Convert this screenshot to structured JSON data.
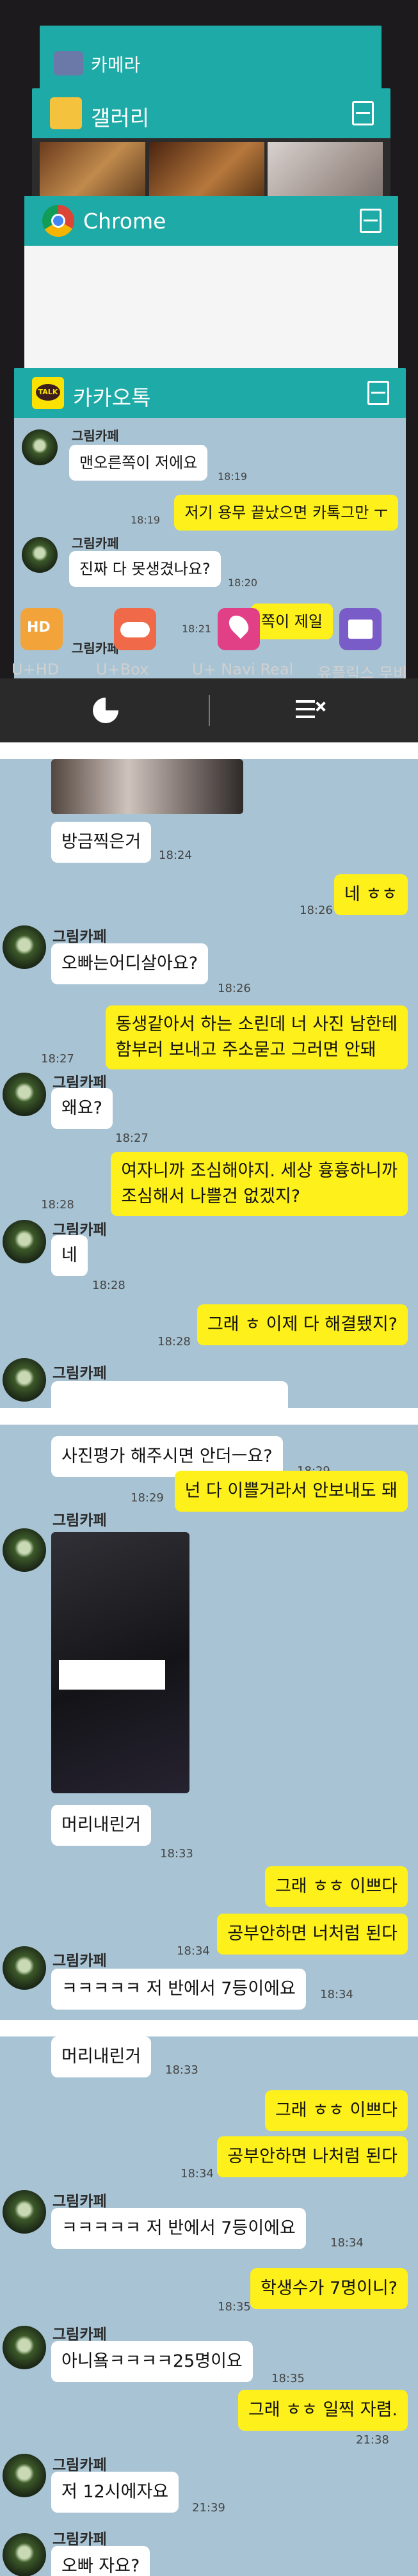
{
  "recents": {
    "camera_title": "카메라",
    "gallery_title": "갤러리",
    "chrome_title": "Chrome",
    "kakao_title": "카카오톡",
    "preview_messages": [
      {
        "kind": "in",
        "sender": "그림카페",
        "text": "맨오른쪽이 저에요",
        "time": "18:19"
      },
      {
        "kind": "out",
        "text": "저기 용무 끝났으면 카톡그만 ㅜ",
        "time": "18:19"
      },
      {
        "kind": "in",
        "sender": "그림카페",
        "text": "진짜 다 못생겼나요?",
        "time": "18:20"
      },
      {
        "kind": "in",
        "sender": "그림카페",
        "text": "",
        "time": "18:21"
      },
      {
        "kind": "out",
        "text": "쪽이 제일",
        "time": ""
      }
    ],
    "dock": [
      {
        "name": "U+HD",
        "label": "U+HD",
        "color": "#f2a43a"
      },
      {
        "name": "U+Box",
        "label": "U+Box",
        "color": "#f06a4a"
      },
      {
        "name": "U+ Navi Real",
        "label": "U+ Navi Real",
        "color": "#e13f86"
      },
      {
        "name": "U+movie",
        "label": "유플릭스 무비",
        "color": "#7a5cc8"
      }
    ],
    "nav": {
      "recent_icon": "pie-icon",
      "close_all_icon": "clear-all-icon"
    }
  },
  "chat1": {
    "messages": [
      {
        "kind": "in",
        "text": "방금찍은거",
        "time": "18:24"
      },
      {
        "kind": "out",
        "text": "네 ㅎㅎ",
        "time": "18:26"
      },
      {
        "kind": "in",
        "sender": "그림카페",
        "text": "오빠는어디살아요?",
        "time": "18:26"
      },
      {
        "kind": "out",
        "text": "동생같아서 하는 소린데 너 사진 남한테\n함부러 보내고 주소묻고 그러면 안돼",
        "time": "18:27"
      },
      {
        "kind": "in",
        "sender": "그림카페",
        "text": "왜요?",
        "time": "18:27"
      },
      {
        "kind": "out",
        "text": "여자니까 조심해야지. 세상 흉흉하니까\n조심해서 나쁠건 없겠지?",
        "time": "18:28"
      },
      {
        "kind": "in",
        "sender": "그림카페",
        "text": "네",
        "time": "18:28"
      },
      {
        "kind": "out",
        "text": "그래 ㅎ 이제 다 해결됐지?",
        "time": "18:28"
      },
      {
        "kind": "in",
        "sender": "그림카페",
        "text": "",
        "time": ""
      }
    ]
  },
  "chat2": {
    "messages": [
      {
        "kind": "in",
        "text": "사진평가 해주시면 안더ㅡ요?",
        "time": "18:29"
      },
      {
        "kind": "out",
        "text": "넌 다 이쁠거라서 안보내도 돼",
        "time": "18:29"
      },
      {
        "kind": "in",
        "sender": "그림카페",
        "text": "머리내린거",
        "time": "18:33"
      },
      {
        "kind": "out",
        "text": "그래 ㅎㅎ 이쁘다",
        "time": ""
      },
      {
        "kind": "out",
        "text": "공부안하면 너처럼 된다",
        "time": "18:34"
      },
      {
        "kind": "in",
        "sender": "그림카페",
        "text": "ㅋㅋㅋㅋㅋ 저 반에서 7등이에요",
        "time": "18:34"
      }
    ]
  },
  "chat3": {
    "messages": [
      {
        "kind": "in",
        "text": "머리내린거",
        "time": "18:33"
      },
      {
        "kind": "out",
        "text": "그래 ㅎㅎ 이쁘다",
        "time": ""
      },
      {
        "kind": "out",
        "text": "공부안하면 나처럼 된다",
        "time": "18:34"
      },
      {
        "kind": "in",
        "sender": "그림카페",
        "text": "ㅋㅋㅋㅋㅋ 저 반에서 7등이에요",
        "time": "18:34"
      },
      {
        "kind": "out",
        "text": "학생수가 7명이니?",
        "time": "18:35"
      },
      {
        "kind": "in",
        "sender": "그림카페",
        "text": "아니욬ㅋㅋㅋㅋ25명이요",
        "time": "18:35"
      },
      {
        "kind": "out",
        "text": "그래 ㅎㅎ 일찍 자렴.",
        "time": "21:38"
      },
      {
        "kind": "in",
        "sender": "그림카페",
        "text": "저 12시에자요",
        "time": "21:39"
      },
      {
        "kind": "in",
        "sender": "그림카페",
        "text": "오빠 자요?",
        "time": ""
      }
    ]
  }
}
